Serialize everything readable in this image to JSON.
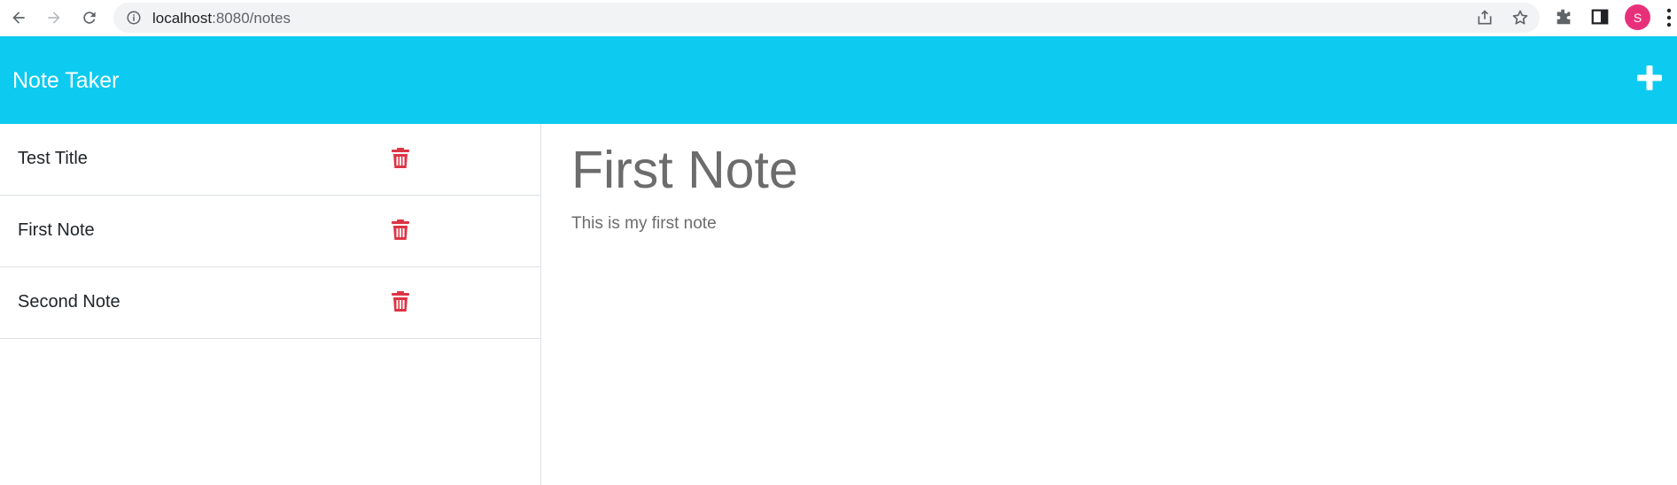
{
  "browser": {
    "url_host": "localhost",
    "url_rest": ":8080/notes",
    "avatar_letter": "S",
    "icons": [
      "back-arrow-icon",
      "forward-arrow-icon",
      "reload-icon",
      "info-icon",
      "share-icon",
      "star-icon",
      "extensions-icon",
      "side-panel-icon",
      "more-vert-icon"
    ]
  },
  "header": {
    "brand": "Note Taker",
    "add_icon": "plus-icon"
  },
  "sidebar": {
    "items": [
      {
        "label": "Test Title"
      },
      {
        "label": "First Note"
      },
      {
        "label": "Second Note"
      }
    ],
    "delete_icon": "trash-icon"
  },
  "main": {
    "title": "First Note",
    "text": "This is my first note"
  },
  "colors": {
    "header_bg": "#0dcaf0",
    "trash": "#dc3545",
    "avatar": "#e8307a"
  }
}
